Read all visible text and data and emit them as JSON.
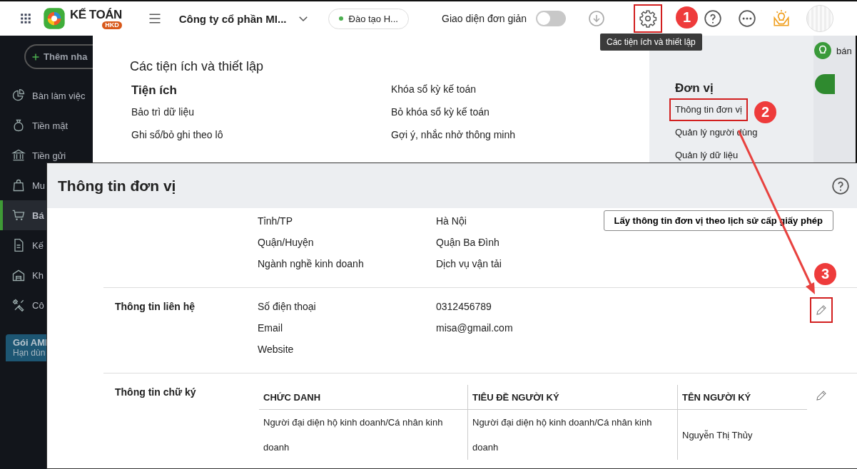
{
  "topbar": {
    "app_name": "KẾ TOÁN",
    "app_badge": "HKD",
    "company": "Công ty cổ phần MI...",
    "branch": {
      "label": "Đào tạo H...",
      "color": "#4caf50"
    },
    "simple_mode": {
      "label": "Giao diện đơn giản",
      "on": false
    },
    "settings_highlighted": true,
    "tooltip": "Các tiện ích và thiết lập"
  },
  "sidebar": {
    "add_button": "Thêm nha",
    "items": [
      {
        "label": "Bàn làm việc",
        "selected": false
      },
      {
        "label": "Tiền mặt",
        "selected": false
      },
      {
        "label": "Tiền gửi",
        "selected": false
      },
      {
        "label": "Mu",
        "selected": false
      },
      {
        "label": "Bá",
        "selected": true
      },
      {
        "label": "Kế",
        "selected": false
      },
      {
        "label": "Kh",
        "selected": false
      },
      {
        "label": "Cô",
        "selected": false
      }
    ],
    "plan": {
      "title": "Gói AMI",
      "subtitle": "Hạn dùn"
    }
  },
  "settings_menu": {
    "title": "Các tiện ích và thiết lập",
    "columns": [
      {
        "heading": "Tiện ích",
        "items": [
          "Bảo trì dữ liệu",
          "Ghi sổ/bỏ ghi theo lô"
        ]
      },
      {
        "items": [
          "Khóa sổ kỳ kế toán",
          "Bỏ khóa sổ kỳ kế toán",
          "Gợi ý, nhắc nhở thông minh"
        ]
      }
    ],
    "side": {
      "heading": "Đơn vị",
      "items": [
        {
          "label": "Thông tin đơn vị",
          "highlighted": true
        },
        {
          "label": "Quản lý người dùng",
          "highlighted": false
        },
        {
          "label": "Quản lý dữ liệu",
          "highlighted": false
        }
      ]
    }
  },
  "background_text": "bán",
  "dialog": {
    "title": "Thông tin đơn vị",
    "sections": [
      {
        "button": "Lấy thông tin đơn vị theo lịch sử cấp giấy phép",
        "fields": [
          {
            "name": "Tỉnh/TP",
            "value": "Hà Nội"
          },
          {
            "name": "Quận/Huyện",
            "value": "Quận Ba Đình"
          },
          {
            "name": "Ngành nghề kinh doanh",
            "value": "Dịch vụ vận tải"
          }
        ]
      },
      {
        "label": "Thông tin liên hệ",
        "edit_highlighted": true,
        "fields": [
          {
            "name": "Số điện thoại",
            "value": "0312456789"
          },
          {
            "name": "Email",
            "value": "misa@gmail.com"
          },
          {
            "name": "Website"
          }
        ]
      },
      {
        "label": "Thông tin chữ ký",
        "edit_highlighted": false,
        "table": {
          "columns": [
            "CHỨC DANH",
            "TIÊU ĐỀ NGƯỜI KÝ",
            "TÊN NGƯỜI KÝ"
          ],
          "rows": [
            [
              "Người đại diện hộ kinh doanh/Cá nhân kinh doanh",
              "Người đại diện hộ kinh doanh/Cá nhân kinh doanh",
              "Nguyễn Thị Thủy"
            ]
          ]
        }
      }
    ]
  },
  "annotations": [
    {
      "number": "1"
    },
    {
      "number": "2"
    },
    {
      "number": "3"
    }
  ]
}
